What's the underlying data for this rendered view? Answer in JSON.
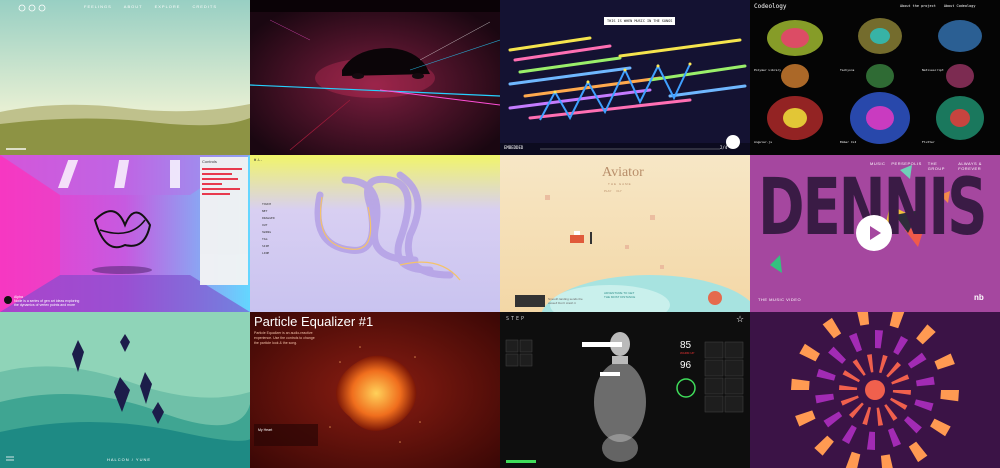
{
  "tiles": {
    "t1": {
      "nav": [
        "FEELINGS",
        "ABOUT",
        "EXPLORE",
        "CREDITS"
      ],
      "colors": {
        "sky_top": "#9ed1c4",
        "sky_bottom": "#e7efd2",
        "hill": "#9a9d5a",
        "ground": "#7e8a3d"
      }
    },
    "t2": {
      "colors": {
        "bg": "#2a0d1b",
        "glow": "#ff3d6e",
        "streak1": "#26d1ff",
        "streak2": "#ff4fd8"
      }
    },
    "t3": {
      "caption": "THIS IS WHEN MUSIC IN THE SONGS",
      "footer_left": "EMBEDDED",
      "footer_right": "2/4"
    },
    "t4": {
      "title": "Codeology",
      "menu": [
        "About the project",
        "About Codeology"
      ],
      "repos": [
        "Polymer Library",
        "Tachyons",
        "Nativescript",
        "Angular.js",
        "Ember CLI",
        "Flutter"
      ]
    },
    "t5": {
      "panel_title": "Controls",
      "caption_lines": [
        "Alpha",
        "Node is a series of gen art ideas exploring",
        "the dynamics of vertex points and more"
      ]
    },
    "t6": {
      "top_left": "W.L.",
      "menu": [
        "TOUCH",
        "NET",
        "DRAGGED",
        "OUT",
        "SWING",
        "TAG",
        "SIZE",
        "LINE"
      ]
    },
    "t7": {
      "title": "Aviator",
      "subtitle": "THE GAME",
      "tabs": [
        "PLAY",
        "FLY"
      ],
      "note_left": [
        "Smooth landing sends the",
        "vessel! Don't crash it"
      ],
      "note_right": [
        "ADVENTURE TO GET",
        "THE MOST DISTANCE"
      ]
    },
    "t8": {
      "nav": [
        "MUSIC",
        "PERSEPOLIS",
        "THE GROUP",
        "ALWAYS & FOREVER"
      ],
      "big_title": "DENNIS",
      "footer": "THE MUSIC VIDEO",
      "badge": "nb"
    },
    "t9": {
      "caption": "HALCON / YUNE"
    },
    "t10": {
      "title": "Particle Equalizer #1",
      "intro": [
        "Particle Equalizer is an audio-reactive",
        "experience. Use the controls to change",
        "the particle look & the song."
      ],
      "track": "My Heart"
    },
    "t11": {
      "brand": "STEP",
      "readouts": [
        {
          "value": "85",
          "label": "BPM"
        },
        {
          "value": "96",
          "label": "SpO2"
        }
      ],
      "status": "WARM UP"
    },
    "t12": {
      "colors": {
        "bg": "#3b1346",
        "ring1": "#f0604d",
        "ring2": "#a22bb4",
        "ring3": "#ff9a52"
      }
    }
  }
}
